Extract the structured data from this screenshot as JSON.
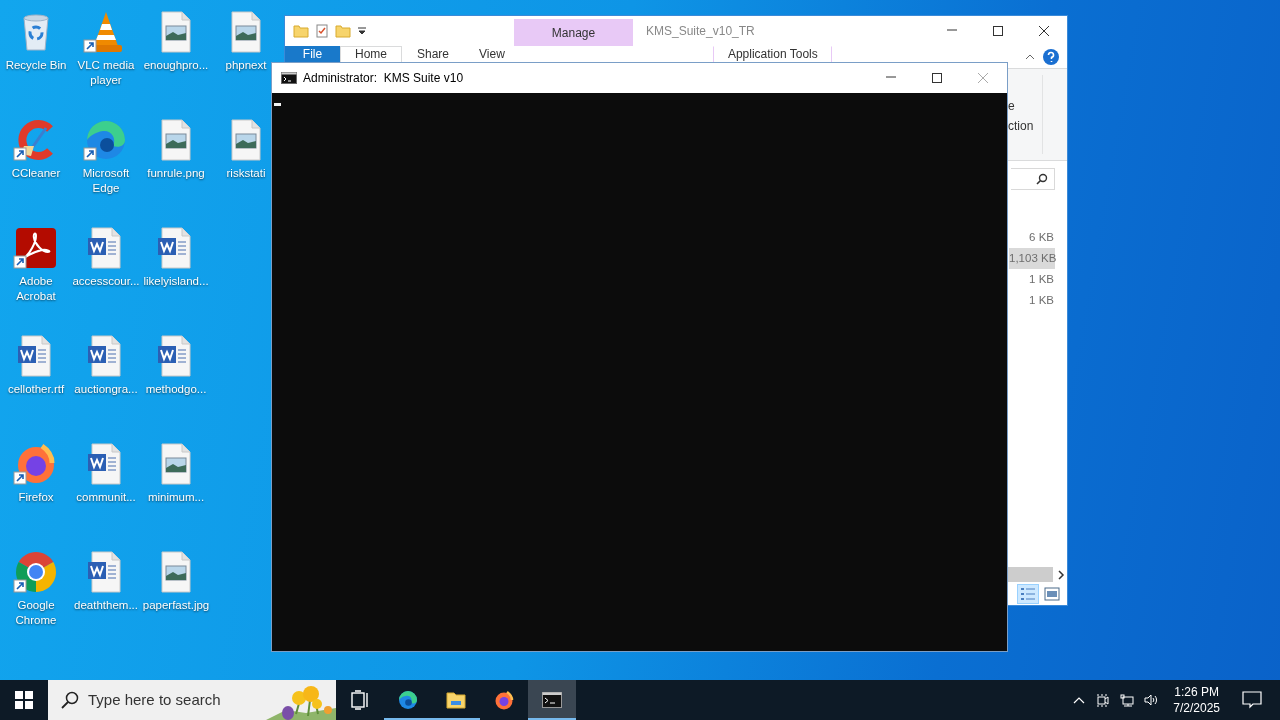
{
  "desktop_icons": [
    {
      "label": "Recycle Bin",
      "kind": "recycle_bin",
      "shortcut": false
    },
    {
      "label": "CCleaner",
      "kind": "ccleaner",
      "shortcut": true
    },
    {
      "label": "Adobe Acrobat",
      "kind": "acrobat",
      "shortcut": true
    },
    {
      "label": "cellother.rtf",
      "kind": "word",
      "shortcut": false
    },
    {
      "label": "Firefox",
      "kind": "firefox",
      "shortcut": true
    },
    {
      "label": "Google Chrome",
      "kind": "chrome",
      "shortcut": true
    },
    {
      "label": "VLC media player",
      "kind": "vlc",
      "shortcut": true
    },
    {
      "label": "Microsoft Edge",
      "kind": "edge",
      "shortcut": true
    },
    {
      "label": "accesscour...",
      "kind": "word",
      "shortcut": false
    },
    {
      "label": "auctiongra...",
      "kind": "word",
      "shortcut": false
    },
    {
      "label": "communit...",
      "kind": "word",
      "shortcut": false
    },
    {
      "label": "deaththem...",
      "kind": "word",
      "shortcut": false
    },
    {
      "label": "enoughpro...",
      "kind": "image",
      "shortcut": false
    },
    {
      "label": "funrule.png",
      "kind": "image",
      "shortcut": false
    },
    {
      "label": "likelyisland...",
      "kind": "word",
      "shortcut": false
    },
    {
      "label": "methodgo...",
      "kind": "word",
      "shortcut": false
    },
    {
      "label": "minimum...",
      "kind": "image",
      "shortcut": false
    },
    {
      "label": "paperfast.jpg",
      "kind": "image",
      "shortcut": false
    },
    {
      "label": "phpnext",
      "kind": "image",
      "shortcut": false
    },
    {
      "label": "riskstati",
      "kind": "image",
      "shortcut": false
    }
  ],
  "explorer": {
    "title": "KMS_Suite_v10_TR",
    "context_header": "Manage",
    "tabs": [
      {
        "label": "File",
        "kind": "file",
        "selected": false
      },
      {
        "label": "Home",
        "kind": "tab",
        "selected": true
      },
      {
        "label": "Share",
        "kind": "tab",
        "selected": false
      },
      {
        "label": "View",
        "kind": "tab",
        "selected": false
      },
      {
        "label": "Application Tools",
        "kind": "context",
        "selected": false
      }
    ],
    "ribbon_texts": [
      "e",
      "ction"
    ],
    "files": [
      {
        "text": "6 KB",
        "selected": false
      },
      {
        "text": "1,103 KB",
        "selected": true
      },
      {
        "text": "1 KB",
        "selected": false
      },
      {
        "text": "1 KB",
        "selected": false
      }
    ],
    "views": [
      {
        "kind": "details",
        "selected": true
      },
      {
        "kind": "large_icons",
        "selected": false
      }
    ]
  },
  "console": {
    "title": "Administrator:  KMS Suite v10"
  },
  "taskbar": {
    "search": {
      "placeholder": "Type here to search"
    },
    "apps": [
      {
        "kind": "task_view",
        "running": false,
        "active": false
      },
      {
        "kind": "edge",
        "running": true,
        "active": false
      },
      {
        "kind": "explorer",
        "running": true,
        "active": false
      },
      {
        "kind": "firefox",
        "running": false,
        "active": false
      },
      {
        "kind": "console",
        "running": true,
        "active": true
      }
    ],
    "time": "1:26 PM",
    "date": "7/2/2025"
  }
}
